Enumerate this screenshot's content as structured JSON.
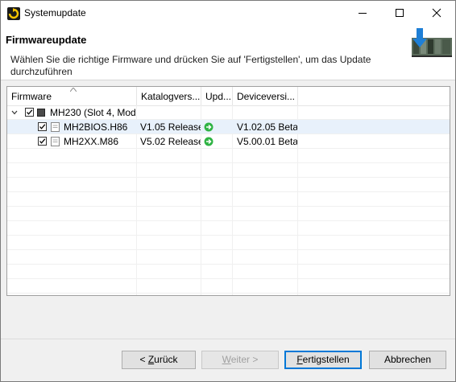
{
  "window": {
    "title": "Systemupdate"
  },
  "header": {
    "title": "Firmwareupdate",
    "description": "Wählen Sie die richtige Firmware und drücken Sie auf 'Fertigstellen', um das Update durchzuführen"
  },
  "table": {
    "columns": [
      "Firmware",
      "Katalogvers...",
      "Upd...",
      "Deviceversi..."
    ],
    "group": {
      "label": "MH230 (Slot 4, Mod",
      "checked": true,
      "expanded": true
    },
    "rows": [
      {
        "name": "MH2BIOS.H86",
        "catalog_version": "V1.05 Release",
        "update_icon": "green-arrow-icon",
        "device_version": "V1.02.05 Beta",
        "checked": true,
        "selected": true
      },
      {
        "name": "MH2XX.M86",
        "catalog_version": "V5.02 Release",
        "update_icon": "green-arrow-icon",
        "device_version": "V5.00.01 Beta",
        "checked": true,
        "selected": false
      }
    ]
  },
  "buttons": {
    "back": {
      "mnemonic": "Z",
      "rest": "urück",
      "prefix": "< "
    },
    "next": {
      "mnemonic": "W",
      "rest": "eiter >"
    },
    "finish": {
      "mnemonic": "F",
      "rest": "ertigstellen"
    },
    "cancel": {
      "label": "Abbrechen"
    }
  },
  "colors": {
    "accent": "#0078d7",
    "selection": "#e8f1fb",
    "update_icon": "#2fb344"
  }
}
